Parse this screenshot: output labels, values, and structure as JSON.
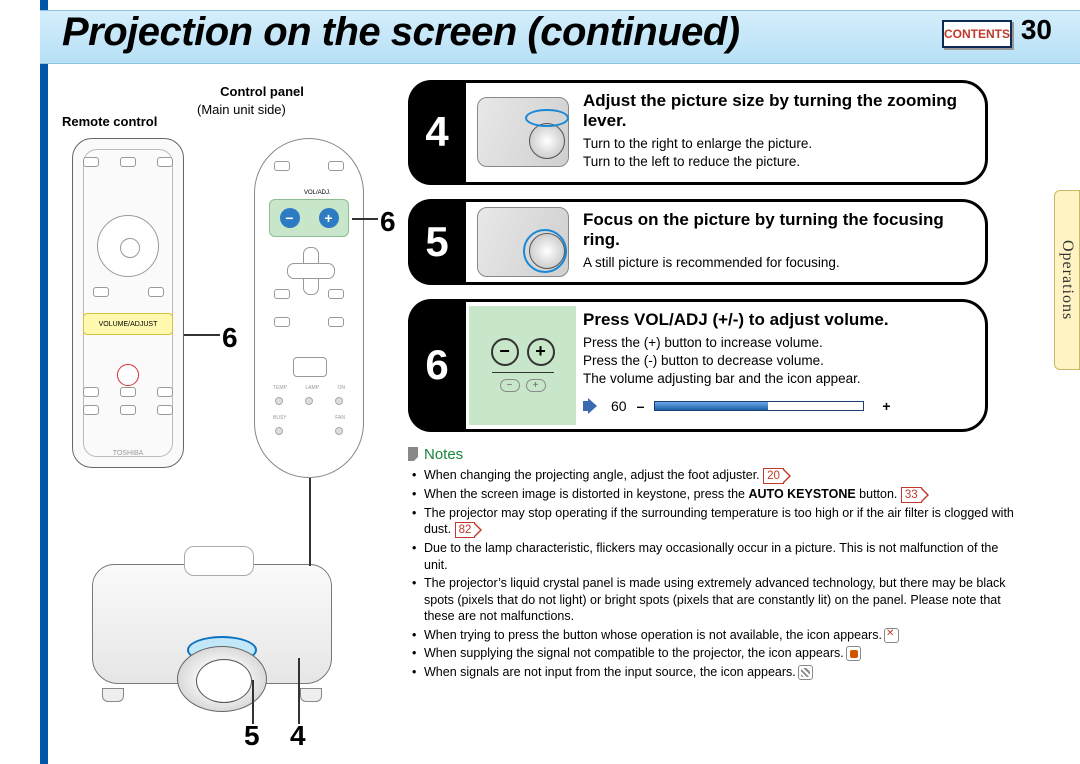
{
  "header": {
    "title": "Projection on the screen (continued)",
    "contents_label": "CONTENTS",
    "page_number": "30"
  },
  "side_tab": "Operations",
  "left": {
    "remote_label": "Remote control",
    "panel_label": "Control panel",
    "panel_sub": "(Main unit side)",
    "voladj_band": "VOLUME/ADJUST",
    "cp_band_lbl": "VOL/ADJ.",
    "brand": "TOSHIBA",
    "callouts": {
      "c6a": "6",
      "c6b": "6",
      "c5": "5",
      "c4": "4"
    }
  },
  "steps": [
    {
      "num": "4",
      "title": "Adjust the picture size by turning the zooming lever.",
      "body": "Turn to the right to enlarge the picture.\nTurn to the left to reduce the picture."
    },
    {
      "num": "5",
      "title": "Focus on the picture by turning the focusing ring.",
      "body": "A still picture is recommended for focusing."
    },
    {
      "num": "6",
      "title": "Press VOL/ADJ (+/-) to adjust volume.",
      "body": "Press the (+) button to increase volume.\nPress the (-) button to decrease volume.\nThe volume adjusting bar and the icon appear."
    }
  ],
  "volume_bar": {
    "value": "60",
    "minus": "–",
    "plus": "+"
  },
  "notes": {
    "heading": "Notes",
    "items": [
      {
        "t1": "When changing the projecting angle, adjust the foot adjuster. ",
        "ref": "20"
      },
      {
        "t1": "When the screen image is distorted in keystone, press the ",
        "bold": "AUTO KEYSTONE",
        "t2": " button. ",
        "ref": "33"
      },
      {
        "t1": "The projector may stop operating if the surrounding temperature is too high or if the air filter is clogged with dust. ",
        "ref": "82"
      },
      {
        "t1": "Due to the lamp characteristic, flickers may occasionally occur in a picture. This is not malfunction of the unit."
      },
      {
        "t1": "The projector’s liquid crystal panel is made using extremely advanced technology, but there may be black spots (pixels that do not light) or bright spots (pixels that are constantly lit) on the panel. Please note that these are not malfunctions."
      },
      {
        "t1": "When trying to press the button whose operation is not available, the icon ",
        "icon": "err",
        "t2": " appears."
      },
      {
        "t1": "When supplying the signal not compatible to the projector, the icon ",
        "icon": "warn",
        "t2": " appears."
      },
      {
        "t1": "When signals are not input from the input source, the icon ",
        "icon": "signal",
        "t2": " appears."
      }
    ]
  }
}
